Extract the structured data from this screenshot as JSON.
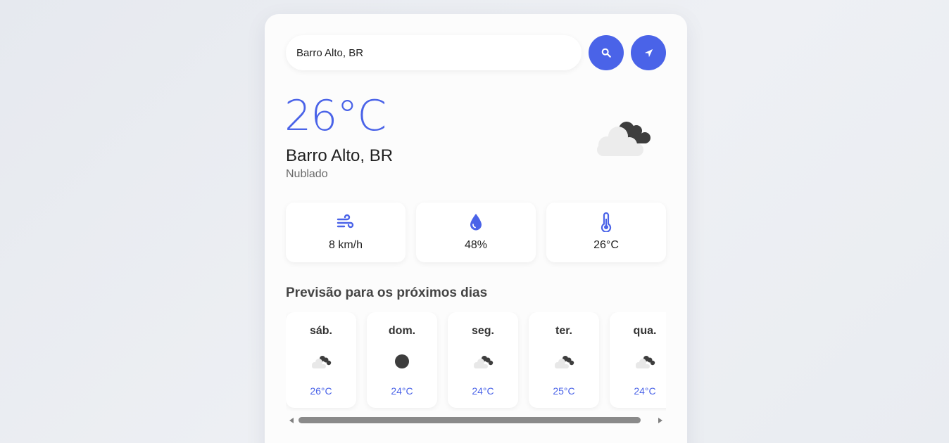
{
  "search": {
    "value": "Barro Alto, BR",
    "search_icon": "search-icon",
    "location_icon": "location-arrow-icon"
  },
  "current": {
    "temperature": "26°C",
    "city": "Barro Alto, BR",
    "description": "Nublado",
    "icon": "cloudy-icon"
  },
  "stats": [
    {
      "icon": "wind-icon",
      "value": "8 km/h"
    },
    {
      "icon": "droplet-icon",
      "value": "48%"
    },
    {
      "icon": "thermometer-icon",
      "value": "26°C"
    }
  ],
  "forecast": {
    "title": "Previsão para os próximos dias",
    "days": [
      {
        "day": "sáb.",
        "icon": "cloudy-icon",
        "temp": "26°C"
      },
      {
        "day": "dom.",
        "icon": "circle-icon",
        "temp": "24°C"
      },
      {
        "day": "seg.",
        "icon": "cloudy-icon",
        "temp": "24°C"
      },
      {
        "day": "ter.",
        "icon": "cloudy-icon",
        "temp": "25°C"
      },
      {
        "day": "qua.",
        "icon": "cloudy-icon",
        "temp": "24°C"
      }
    ]
  },
  "colors": {
    "accent": "#4a63e8",
    "background": "#e9ecf1",
    "card": "#fcfcfc"
  }
}
